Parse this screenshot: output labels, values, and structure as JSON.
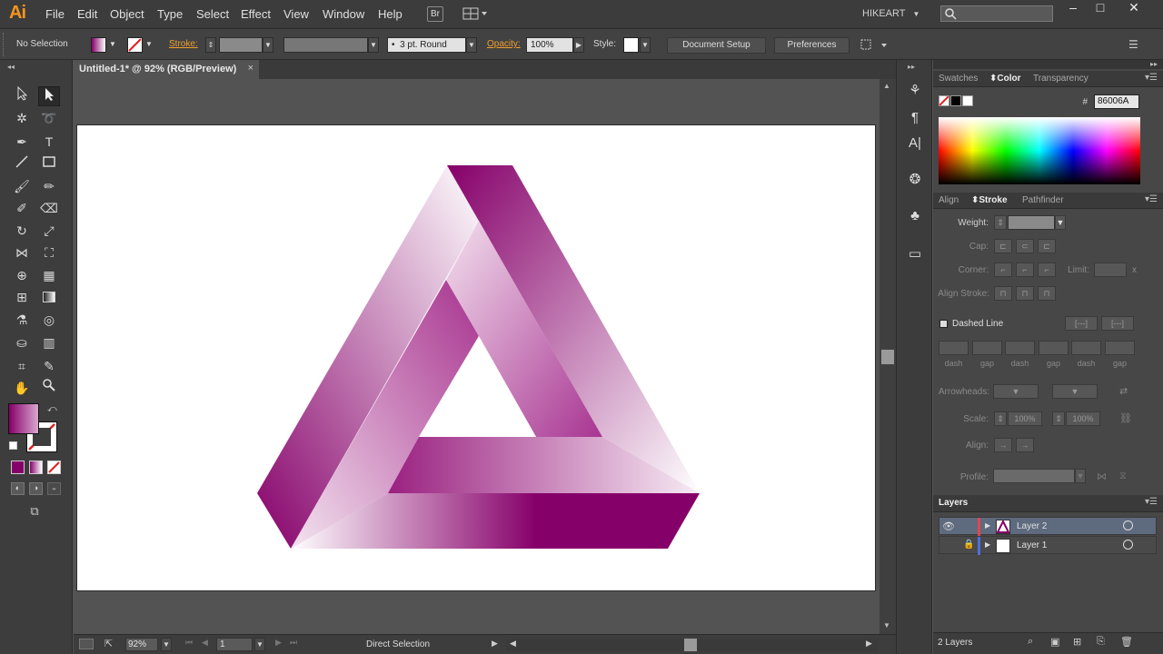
{
  "menubar": {
    "logo": "Ai",
    "items": [
      "File",
      "Edit",
      "Object",
      "Type",
      "Select",
      "Effect",
      "View",
      "Window",
      "Help"
    ],
    "bridge_label": "Br",
    "workspace": "HIKEART",
    "win_min": "–",
    "win_max": "□",
    "win_close": "✕"
  },
  "control": {
    "selection": "No Selection",
    "stroke_label": "Stroke:",
    "brush": "3 pt. Round",
    "opacity_label": "Opacity:",
    "opacity_value": "100%",
    "style_label": "Style:",
    "document_setup": "Document Setup",
    "preferences": "Preferences"
  },
  "document": {
    "tab_title": "Untitled-1* @ 92% (RGB/Preview)",
    "tab_close": "×"
  },
  "status": {
    "zoom": "92%",
    "artboard": "1",
    "tool_name": "Direct Selection"
  },
  "color_panel": {
    "tabs": [
      "Swatches",
      "Color",
      "Transparency"
    ],
    "hash": "#",
    "hex": "86006A"
  },
  "stroke_panel": {
    "tabs": [
      "Align",
      "Stroke",
      "Pathfinder"
    ],
    "weight": "Weight:",
    "cap": "Cap:",
    "corner": "Corner:",
    "limit": "Limit:",
    "limit_unit": "x",
    "align_stroke": "Align Stroke:",
    "dashed_line": "Dashed Line",
    "dash_labels": [
      "dash",
      "gap",
      "dash",
      "gap",
      "dash",
      "gap"
    ],
    "arrowheads": "Arrowheads:",
    "scale": "Scale:",
    "scale_1": "100%",
    "scale_2": "100%",
    "align": "Align:",
    "profile": "Profile:"
  },
  "layers_panel": {
    "title": "Layers",
    "layers": [
      {
        "name": "Layer 2",
        "color": "#e0464f"
      },
      {
        "name": "Layer 1",
        "color": "#4f6ee0"
      }
    ],
    "count": "2 Layers"
  },
  "colors": {
    "accent": "#86006A",
    "stroke_orange": "#f0a030"
  }
}
